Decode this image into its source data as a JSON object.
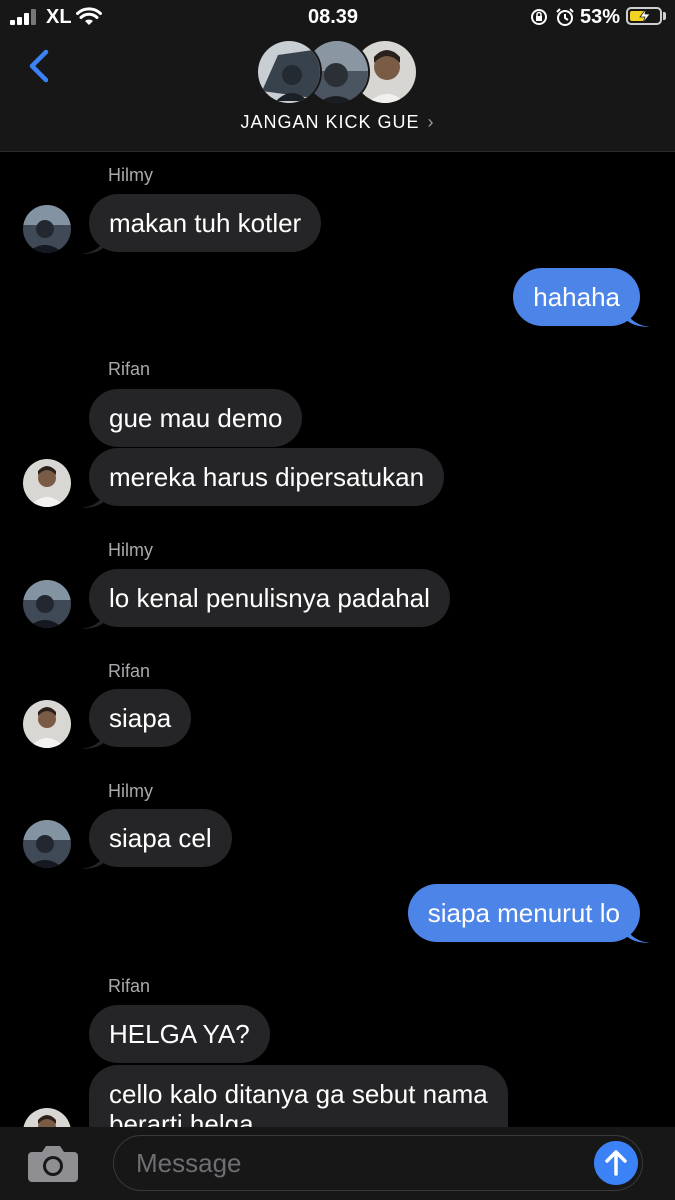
{
  "status_bar": {
    "carrier": "XL",
    "time": "08.39",
    "battery": "53%",
    "battery_level": 0.53
  },
  "header": {
    "group_name": "JANGAN KICK GUE",
    "chevron": "›"
  },
  "messages": [
    {
      "sender": "Hilmy",
      "text": "makan tuh kotler"
    },
    {
      "text": "hahaha"
    },
    {
      "sender": "Rifan",
      "text": "gue mau demo"
    },
    {
      "text": "mereka harus dipersatukan"
    },
    {
      "sender": "Hilmy",
      "text": "lo kenal penulisnya padahal"
    },
    {
      "sender": "Rifan",
      "text": "siapa"
    },
    {
      "sender": "Hilmy",
      "text": "siapa cel"
    },
    {
      "text": "siapa menurut lo"
    },
    {
      "sender": "Rifan",
      "text": "HELGA YA?"
    },
    {
      "text": "cello kalo ditanya ga sebut nama"
    },
    {
      "text": "berarti helga"
    }
  ],
  "composer": {
    "placeholder": "Message"
  },
  "colors": {
    "outgoing_bubble": "#4d84e8",
    "incoming_bubble": "#252527",
    "send_button": "#3b82f6",
    "battery_fill": "#f2d31f"
  }
}
